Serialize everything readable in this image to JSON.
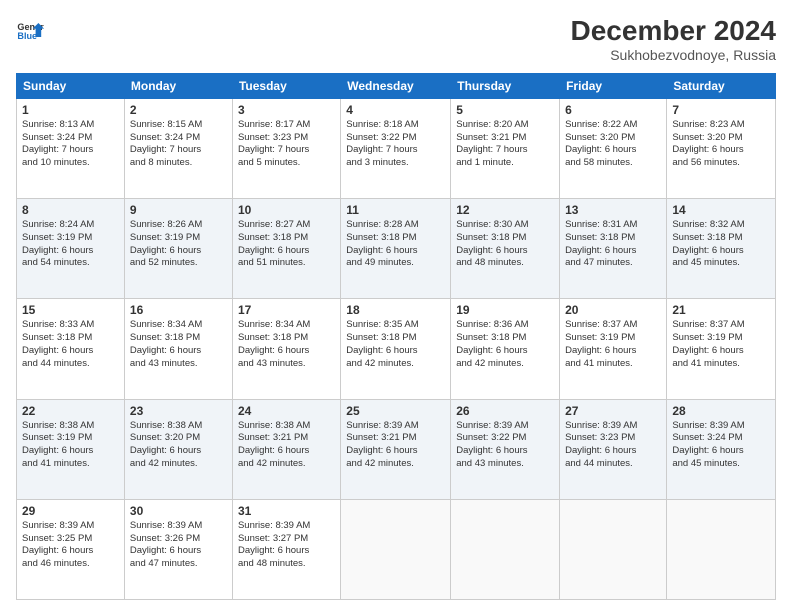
{
  "logo": {
    "line1": "General",
    "line2": "Blue"
  },
  "title": "December 2024",
  "location": "Sukhobezvodnoye, Russia",
  "headers": [
    "Sunday",
    "Monday",
    "Tuesday",
    "Wednesday",
    "Thursday",
    "Friday",
    "Saturday"
  ],
  "weeks": [
    [
      {
        "day": "1",
        "info": "Sunrise: 8:13 AM\nSunset: 3:24 PM\nDaylight: 7 hours\nand 10 minutes."
      },
      {
        "day": "2",
        "info": "Sunrise: 8:15 AM\nSunset: 3:24 PM\nDaylight: 7 hours\nand 8 minutes."
      },
      {
        "day": "3",
        "info": "Sunrise: 8:17 AM\nSunset: 3:23 PM\nDaylight: 7 hours\nand 5 minutes."
      },
      {
        "day": "4",
        "info": "Sunrise: 8:18 AM\nSunset: 3:22 PM\nDaylight: 7 hours\nand 3 minutes."
      },
      {
        "day": "5",
        "info": "Sunrise: 8:20 AM\nSunset: 3:21 PM\nDaylight: 7 hours\nand 1 minute."
      },
      {
        "day": "6",
        "info": "Sunrise: 8:22 AM\nSunset: 3:20 PM\nDaylight: 6 hours\nand 58 minutes."
      },
      {
        "day": "7",
        "info": "Sunrise: 8:23 AM\nSunset: 3:20 PM\nDaylight: 6 hours\nand 56 minutes."
      }
    ],
    [
      {
        "day": "8",
        "info": "Sunrise: 8:24 AM\nSunset: 3:19 PM\nDaylight: 6 hours\nand 54 minutes."
      },
      {
        "day": "9",
        "info": "Sunrise: 8:26 AM\nSunset: 3:19 PM\nDaylight: 6 hours\nand 52 minutes."
      },
      {
        "day": "10",
        "info": "Sunrise: 8:27 AM\nSunset: 3:18 PM\nDaylight: 6 hours\nand 51 minutes."
      },
      {
        "day": "11",
        "info": "Sunrise: 8:28 AM\nSunset: 3:18 PM\nDaylight: 6 hours\nand 49 minutes."
      },
      {
        "day": "12",
        "info": "Sunrise: 8:30 AM\nSunset: 3:18 PM\nDaylight: 6 hours\nand 48 minutes."
      },
      {
        "day": "13",
        "info": "Sunrise: 8:31 AM\nSunset: 3:18 PM\nDaylight: 6 hours\nand 47 minutes."
      },
      {
        "day": "14",
        "info": "Sunrise: 8:32 AM\nSunset: 3:18 PM\nDaylight: 6 hours\nand 45 minutes."
      }
    ],
    [
      {
        "day": "15",
        "info": "Sunrise: 8:33 AM\nSunset: 3:18 PM\nDaylight: 6 hours\nand 44 minutes."
      },
      {
        "day": "16",
        "info": "Sunrise: 8:34 AM\nSunset: 3:18 PM\nDaylight: 6 hours\nand 43 minutes."
      },
      {
        "day": "17",
        "info": "Sunrise: 8:34 AM\nSunset: 3:18 PM\nDaylight: 6 hours\nand 43 minutes."
      },
      {
        "day": "18",
        "info": "Sunrise: 8:35 AM\nSunset: 3:18 PM\nDaylight: 6 hours\nand 42 minutes."
      },
      {
        "day": "19",
        "info": "Sunrise: 8:36 AM\nSunset: 3:18 PM\nDaylight: 6 hours\nand 42 minutes."
      },
      {
        "day": "20",
        "info": "Sunrise: 8:37 AM\nSunset: 3:19 PM\nDaylight: 6 hours\nand 41 minutes."
      },
      {
        "day": "21",
        "info": "Sunrise: 8:37 AM\nSunset: 3:19 PM\nDaylight: 6 hours\nand 41 minutes."
      }
    ],
    [
      {
        "day": "22",
        "info": "Sunrise: 8:38 AM\nSunset: 3:19 PM\nDaylight: 6 hours\nand 41 minutes."
      },
      {
        "day": "23",
        "info": "Sunrise: 8:38 AM\nSunset: 3:20 PM\nDaylight: 6 hours\nand 42 minutes."
      },
      {
        "day": "24",
        "info": "Sunrise: 8:38 AM\nSunset: 3:21 PM\nDaylight: 6 hours\nand 42 minutes."
      },
      {
        "day": "25",
        "info": "Sunrise: 8:39 AM\nSunset: 3:21 PM\nDaylight: 6 hours\nand 42 minutes."
      },
      {
        "day": "26",
        "info": "Sunrise: 8:39 AM\nSunset: 3:22 PM\nDaylight: 6 hours\nand 43 minutes."
      },
      {
        "day": "27",
        "info": "Sunrise: 8:39 AM\nSunset: 3:23 PM\nDaylight: 6 hours\nand 44 minutes."
      },
      {
        "day": "28",
        "info": "Sunrise: 8:39 AM\nSunset: 3:24 PM\nDaylight: 6 hours\nand 45 minutes."
      }
    ],
    [
      {
        "day": "29",
        "info": "Sunrise: 8:39 AM\nSunset: 3:25 PM\nDaylight: 6 hours\nand 46 minutes."
      },
      {
        "day": "30",
        "info": "Sunrise: 8:39 AM\nSunset: 3:26 PM\nDaylight: 6 hours\nand 47 minutes."
      },
      {
        "day": "31",
        "info": "Sunrise: 8:39 AM\nSunset: 3:27 PM\nDaylight: 6 hours\nand 48 minutes."
      },
      {
        "day": "",
        "info": ""
      },
      {
        "day": "",
        "info": ""
      },
      {
        "day": "",
        "info": ""
      },
      {
        "day": "",
        "info": ""
      }
    ]
  ]
}
